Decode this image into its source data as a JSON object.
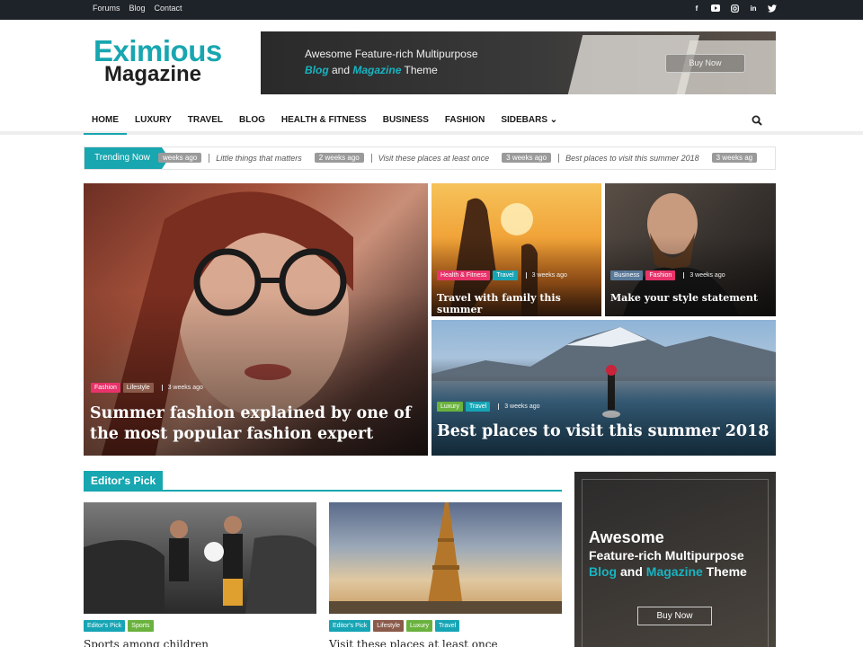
{
  "topbar": {
    "links": [
      "Forums",
      "Blog",
      "Contact"
    ],
    "social_icons": [
      "facebook-icon",
      "youtube-icon",
      "instagram-icon",
      "linkedin-icon",
      "twitter-icon"
    ]
  },
  "logo": {
    "line1": "Eximious",
    "line2": "Magazine"
  },
  "banner": {
    "line1": "Awesome Feature-rich Multipurpose",
    "blog": "Blog",
    "and": " and ",
    "magazine": "Magazine",
    "theme": " Theme",
    "button": "Buy Now"
  },
  "nav": {
    "items": [
      "HOME",
      "LUXURY",
      "TRAVEL",
      "BLOG",
      "HEALTH & FITNESS",
      "BUSINESS",
      "FASHION",
      "SIDEBARS"
    ],
    "active": "HOME",
    "search_icon": "search-icon"
  },
  "trending": {
    "label": "Trending Now",
    "items": [
      {
        "badge": "weeks ago",
        "text": "Little things that matters"
      },
      {
        "badge": "2 weeks ago",
        "text": "Visit these places at least once"
      },
      {
        "badge": "3 weeks ago",
        "text": "Best places to visit this summer 2018"
      },
      {
        "badge": "3 weeks ag",
        "text": ""
      }
    ]
  },
  "hero": {
    "main": {
      "tags": [
        "Fashion",
        "Lifestyle"
      ],
      "time": "3 weeks ago",
      "title": "Summer fashion explained by one of the most popular fashion expert"
    },
    "top_left": {
      "tags": [
        "Health & Fitness",
        "Travel"
      ],
      "time": "3 weeks ago",
      "title": "Travel with family this summer"
    },
    "top_right": {
      "tags": [
        "Business",
        "Fashion"
      ],
      "time": "3 weeks ago",
      "title": "Make your style statement"
    },
    "bottom": {
      "tags": [
        "Luxury",
        "Travel"
      ],
      "time": "3 weeks ago",
      "title": "Best places to visit this summer 2018"
    }
  },
  "editors_pick": {
    "title": "Editor's Pick",
    "posts": [
      {
        "tags": [
          "Editor's Pick",
          "Sports"
        ],
        "title": "Sports among children"
      },
      {
        "tags": [
          "Editor's Pick",
          "Lifestyle",
          "Luxury",
          "Travel"
        ],
        "title": "Visit these places at least once"
      }
    ]
  },
  "side_ad": {
    "line1": "Awesome",
    "line2": "Feature-rich Multipurpose",
    "blog": "Blog",
    "and": " and ",
    "magazine": "Magazine",
    "theme": " Theme",
    "button": "Buy Now"
  },
  "colors": {
    "accent": "#18a6b0",
    "tag_fashion": "#e8336a",
    "tag_lifestyle": "#8a5a4a",
    "tag_health": "#e8336a",
    "tag_travel": "#17a5b5",
    "tag_business": "#5a7a9a",
    "tag_luxury": "#6ab23e",
    "tag_editors": "#17a5b5",
    "tag_sports": "#6ab23e"
  }
}
